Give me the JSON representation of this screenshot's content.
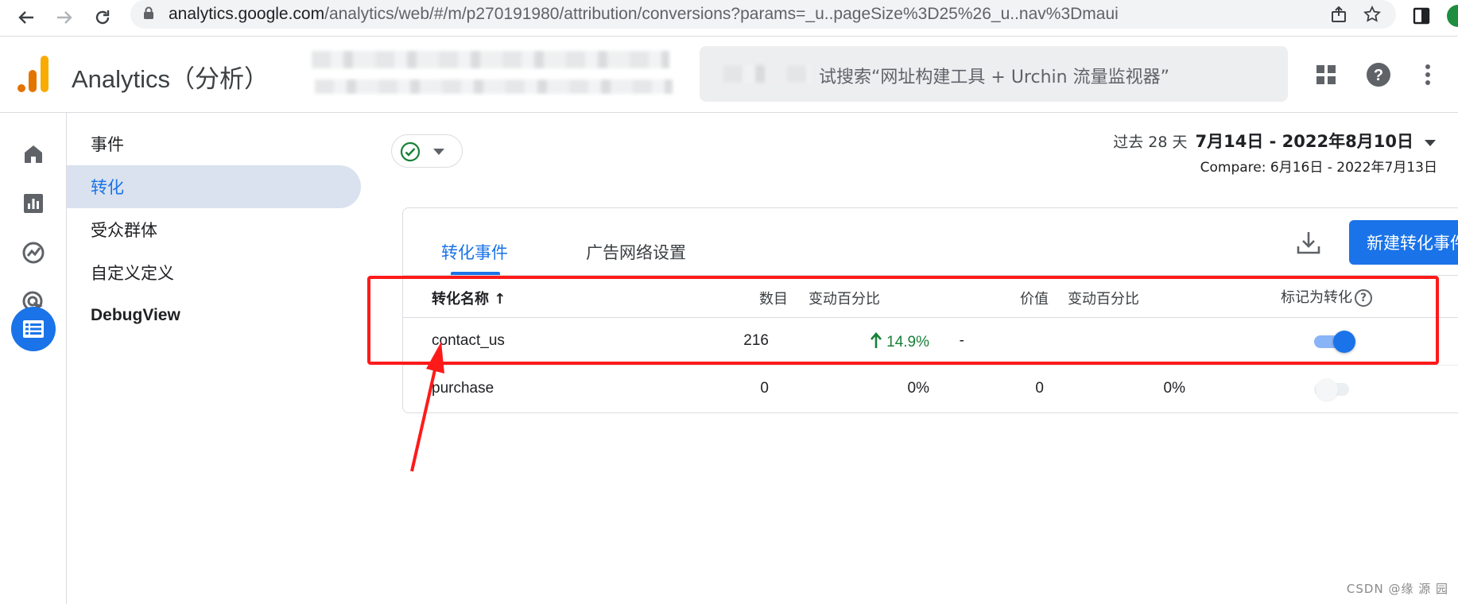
{
  "browser": {
    "url_host": "analytics.google.com",
    "url_path": "/analytics/web/#/m/p270191980/attribution/conversions?params=_u..pageSize%3D25%26_u..nav%3Dmaui"
  },
  "header": {
    "app_title": "Analytics（分析）",
    "search_placeholder": "试搜索“网址构建工具 + Urchin 流量监视器”"
  },
  "subnav": {
    "items": [
      {
        "label": "事件"
      },
      {
        "label": "转化"
      },
      {
        "label": "受众群体"
      },
      {
        "label": "自定义定义"
      },
      {
        "label": "DebugView"
      }
    ]
  },
  "date": {
    "period": "过去 28 天",
    "range": "7月14日 - 2022年8月10日",
    "compare": "Compare: 6月16日 - 2022年7月13日"
  },
  "card": {
    "tabs": [
      "转化事件",
      "广告网络设置"
    ],
    "new_button": "新建转化事件",
    "columns": {
      "name": "转化名称 ↑",
      "count": "数目",
      "count_change": "变动百分比",
      "value": "价值",
      "value_change": "变动百分比",
      "mark": "标记为转化"
    },
    "rows": [
      {
        "name": "contact_us",
        "count": "216",
        "count_change": "14.9%",
        "value": "-",
        "value_change": "",
        "marked": true
      },
      {
        "name": "purchase",
        "count": "0",
        "count_change": "0%",
        "value": "0",
        "value_change": "0%",
        "marked": false
      }
    ]
  },
  "watermark": "CSDN @缘 源 园",
  "colors": {
    "accent": "#1a73e8",
    "positive": "#188038",
    "annotation": "#ff1a1a"
  }
}
